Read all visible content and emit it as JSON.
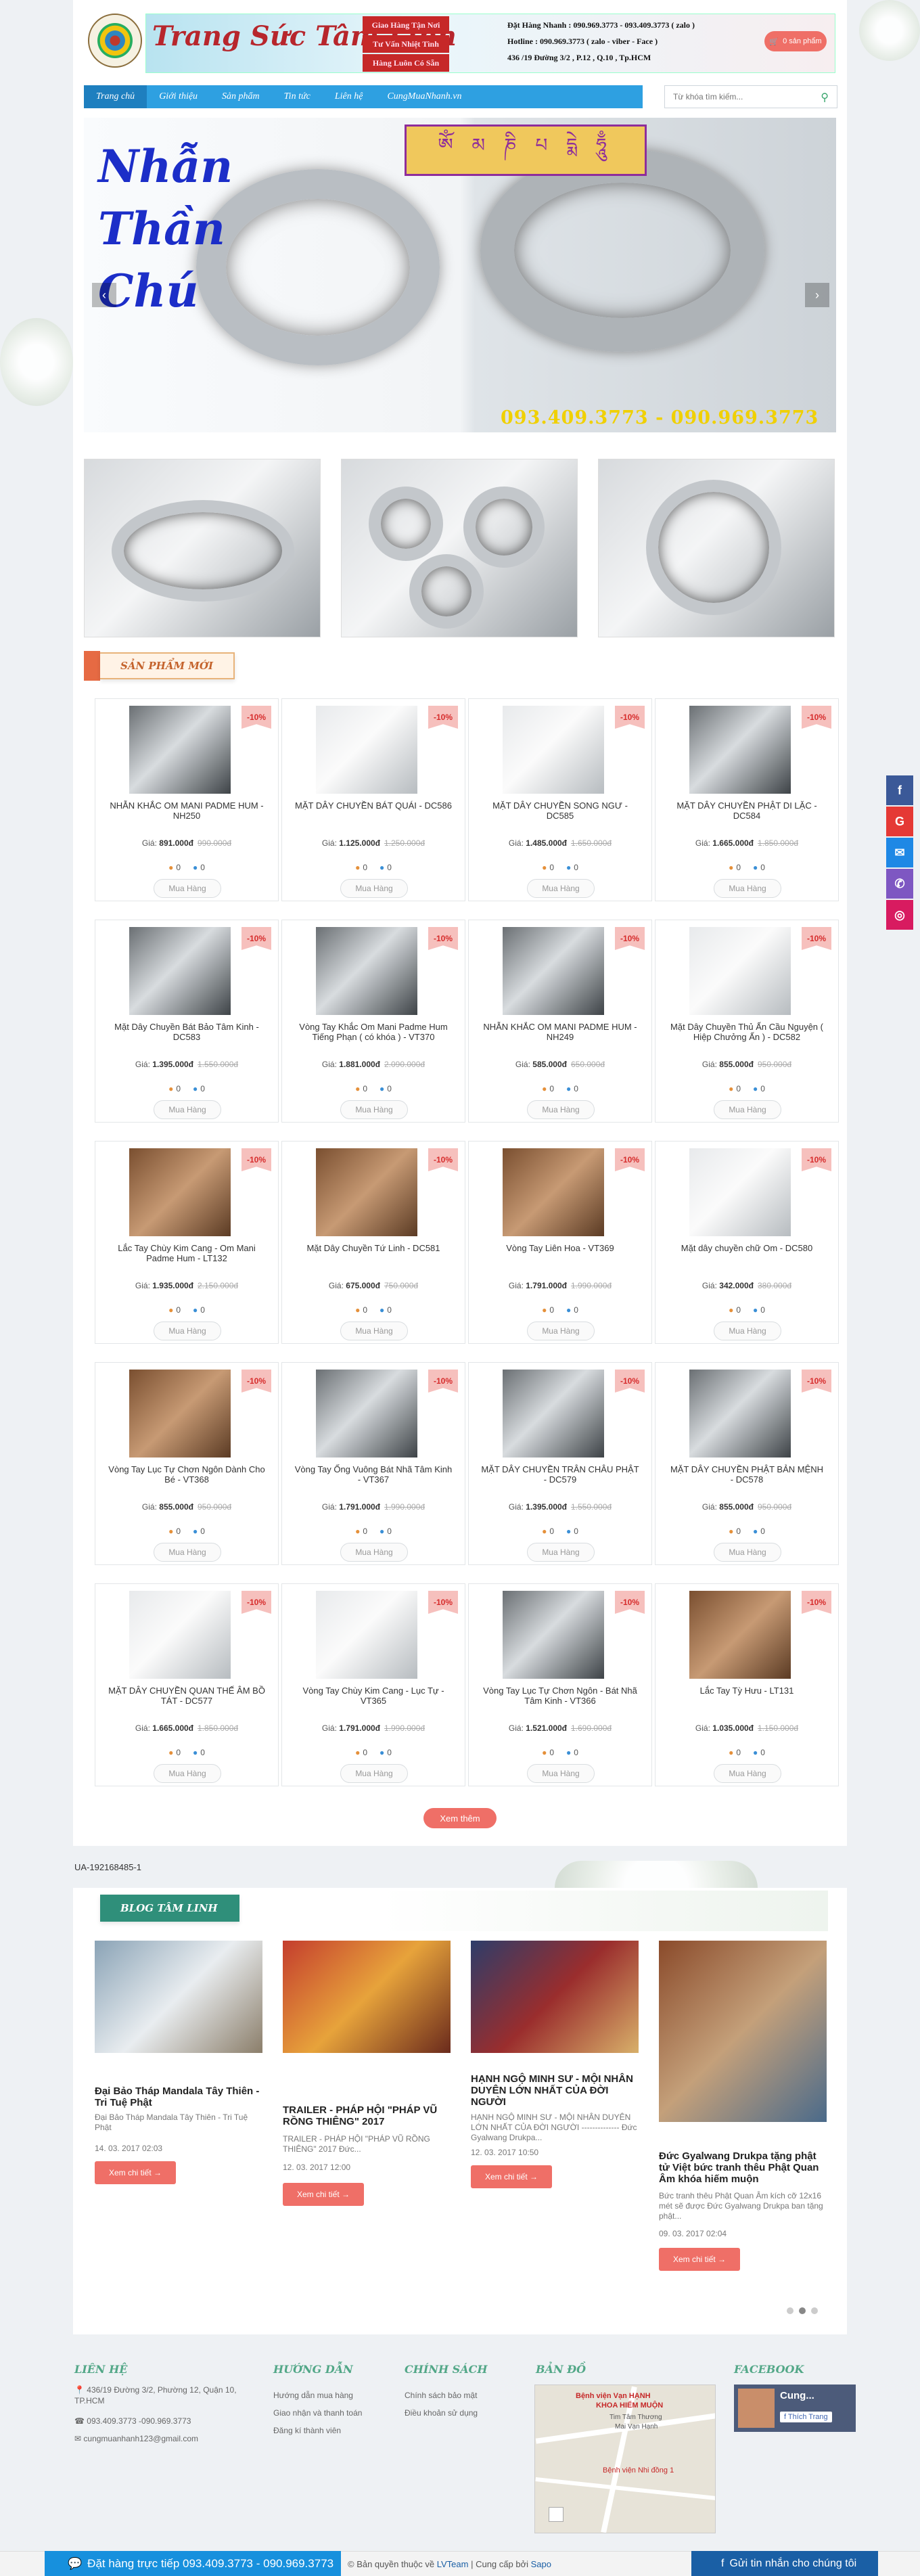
{
  "header": {
    "brand": "Trang Sức Tâm Linh",
    "tags": [
      "Giao Hàng Tận Nơi",
      "Tư Vấn Nhiệt Tình",
      "Hàng Luôn Có Sẵn"
    ],
    "info_lines": [
      "Đặt Hàng Nhanh : 090.969.3773 - 093.409.3773 ( zalo )",
      "Hotline : 090.969.3773 ( zalo - viber - Face )",
      "436 /19 Đường 3/2 , P.12 , Q.10 , Tp.HCM"
    ],
    "cart_label": "0 sản phẩm"
  },
  "nav": {
    "items": [
      "Trang chủ",
      "Giới thiệu",
      "Sản phẩm",
      "Tin tức",
      "Liên hệ",
      "CungMuaNhanh.vn"
    ],
    "search_placeholder": "Từ khóa tìm kiếm..."
  },
  "slider": {
    "title": "Nhẫn\nThần\nChú",
    "mantra": "ༀ མ ཎི པ དྨེ ཧཱུྃ",
    "phone": "093.409.3773 - 090.969.3773"
  },
  "new_products": {
    "heading": "SẢN PHẨM MỚI",
    "buy_label": "Mua Hàng",
    "price_label": "Giá:",
    "discount": "-10%",
    "items": [
      {
        "name": "NHẪN KHẮC OM MANI PADME HUM - NH250",
        "price": "891.000đ",
        "old": "990.000đ",
        "likes": "0",
        "comments": "0",
        "img": "d"
      },
      {
        "name": "MẶT DÂY CHUYỀN BÁT QUÁI - DC586",
        "price": "1.125.000đ",
        "old": "1.250.000đ",
        "likes": "0",
        "comments": "0",
        "img": "l"
      },
      {
        "name": "MẶT DÂY CHUYỀN SONG NGƯ - DC585",
        "price": "1.485.000đ",
        "old": "1.650.000đ",
        "likes": "0",
        "comments": "0",
        "img": "l"
      },
      {
        "name": "MẶT DÂY CHUYỀN PHẬT DI LẶC - DC584",
        "price": "1.665.000đ",
        "old": "1.850.000đ",
        "likes": "0",
        "comments": "0",
        "img": "d"
      },
      {
        "name": "Mặt Dây Chuyền Bát Bảo Tâm Kinh - DC583",
        "price": "1.395.000đ",
        "old": "1.550.000đ",
        "likes": "0",
        "comments": "0",
        "img": "d"
      },
      {
        "name": "Vòng Tay Khắc Om Mani Padme Hum Tiếng Phạn ( có khóa ) - VT370",
        "price": "1.881.000đ",
        "old": "2.090.000đ",
        "likes": "0",
        "comments": "0",
        "img": "d"
      },
      {
        "name": "NHẪN KHẮC OM MANI PADME HUM - NH249",
        "price": "585.000đ",
        "old": "650.000đ",
        "likes": "0",
        "comments": "0",
        "img": "d"
      },
      {
        "name": "Mặt Dây Chuyền Thủ Ấn Cầu Nguyện ( Hiệp Chưởng Ấn ) - DC582",
        "price": "855.000đ",
        "old": "950.000đ",
        "likes": "0",
        "comments": "0",
        "img": "l"
      },
      {
        "name": "Lắc Tay Chùy Kim Cang - Om Mani Padme Hum - LT132",
        "price": "1.935.000đ",
        "old": "2.150.000đ",
        "likes": "0",
        "comments": "0",
        "img": "b"
      },
      {
        "name": "Mặt Dây Chuyền Tứ Linh - DC581",
        "price": "675.000đ",
        "old": "750.000đ",
        "likes": "0",
        "comments": "0",
        "img": "b"
      },
      {
        "name": "Vòng Tay Liên Hoa - VT369",
        "price": "1.791.000đ",
        "old": "1.990.000đ",
        "likes": "0",
        "comments": "0",
        "img": "b"
      },
      {
        "name": "Mặt dây chuyền chữ Om - DC580",
        "price": "342.000đ",
        "old": "380.000đ",
        "likes": "0",
        "comments": "0",
        "img": "l"
      },
      {
        "name": "Vòng Tay Lục Tự Chơn Ngôn Dành Cho Bé - VT368",
        "price": "855.000đ",
        "old": "950.000đ",
        "likes": "0",
        "comments": "0",
        "img": "b"
      },
      {
        "name": "Vòng Tay Ống Vuông Bát Nhã Tâm Kinh - VT367",
        "price": "1.791.000đ",
        "old": "1.990.000đ",
        "likes": "0",
        "comments": "0",
        "img": "d"
      },
      {
        "name": "MẶT DÂY CHUYỀN TRÂN CHÂU PHẬT - DC579",
        "price": "1.395.000đ",
        "old": "1.550.000đ",
        "likes": "0",
        "comments": "0",
        "img": "d"
      },
      {
        "name": "MẶT DÂY CHUYỀN PHẬT BẢN MỆNH - DC578",
        "price": "855.000đ",
        "old": "950.000đ",
        "likes": "0",
        "comments": "0",
        "img": "d"
      },
      {
        "name": "MẶT DÂY CHUYỀN QUAN THẾ ÂM BỒ TÁT - DC577",
        "price": "1.665.000đ",
        "old": "1.850.000đ",
        "likes": "0",
        "comments": "0",
        "img": "l"
      },
      {
        "name": "Vòng Tay Chùy Kim Cang - Lục Tự - VT365",
        "price": "1.791.000đ",
        "old": "1.990.000đ",
        "likes": "0",
        "comments": "0",
        "img": "l"
      },
      {
        "name": "Vòng Tay Lục Tự Chơn Ngôn - Bát Nhã Tâm Kinh - VT366",
        "price": "1.521.000đ",
        "old": "1.690.000đ",
        "likes": "0",
        "comments": "0",
        "img": "d"
      },
      {
        "name": "Lắc Tay Tỳ Hưu - LT131",
        "price": "1.035.000đ",
        "old": "1.150.000đ",
        "likes": "0",
        "comments": "0",
        "img": "b"
      }
    ],
    "more_label": "Xem thêm"
  },
  "ua_code": "UA-192168485-1",
  "blog": {
    "heading": "BLOG TÂM LINH",
    "read_more": "Xem chi tiết →",
    "posts": [
      {
        "title": "Đại Bảo Tháp Mandala Tây Thiên - Tri Tuệ Phật",
        "excerpt": "Đại Bảo Tháp Mandala Tây Thiên - Tri Tuệ Phật",
        "date": "14. 03. 2017 02:03"
      },
      {
        "title": "TRAILER - PHÁP HỘI \"PHÁP VŨ RỒNG THIÊNG\" 2017",
        "excerpt": "TRAILER - PHÁP HỘI \"PHÁP VŨ RỒNG THIÊNG\" 2017 Đức...",
        "date": "12. 03. 2017 12:00"
      },
      {
        "title": "HẠNH NGỘ MINH SƯ - MỘI NHÂN DUYÊN LỚN NHẤT CỦA ĐỜI NGƯỜI",
        "excerpt": "HẠNH NGỘ MINH SƯ - MỘI NHÂN DUYÊN LỚN NHẤT CỦA ĐỜI NGƯỜI -------------- Đức Gyalwang Drukpa...",
        "date": "12. 03. 2017 10:50"
      },
      {
        "title": "Đức Gyalwang Drukpa tặng phật tử Việt bức tranh thêu Phật Quan Âm khóa hiếm muộn",
        "excerpt": "Bức tranh thêu Phật Quan Âm kích cỡ 12x16 mét sẽ được Đức Gyalwang Drukpa ban tặng phật...",
        "date": "09. 03. 2017 02:04"
      }
    ]
  },
  "footer": {
    "contact_heading": "LIÊN HỆ",
    "address": "436/19 Đường 3/2, Phường 12, Quận 10, TP.HCM",
    "phones": "093.409.3773 -090.969.3773",
    "email": "cungmuanhanh123@gmail.com",
    "guide_heading": "HƯỚNG DẪN",
    "guide_items": [
      "Hướng dẫn mua hàng",
      "Giao nhận và thanh toán",
      "Đăng kí thành viên"
    ],
    "policy_heading": "CHÍNH SÁCH",
    "policy_items": [
      "Chính sách bảo mật",
      "Điều khoản sử dụng"
    ],
    "map_heading": "BẢN ĐỒ",
    "map_labels": [
      "Bệnh viện Vạn HẠNH",
      "KHOA HIẾM MUỘN",
      "Bệnh viện Nhi đồng 1",
      "Tim Tâm Thương",
      "Mai Vạn Hạnh"
    ],
    "facebook_heading": "FACEBOOK",
    "fb_name": "Cung...",
    "fb_like": "Thích Trang"
  },
  "bottom": {
    "call": "Đặt hàng trực tiếp 093.409.3773 - 090.969.3773",
    "copyright_prefix": "© Bản quyền thuộc về",
    "team": "LVTeam",
    "provider_prefix": "| Cung cấp bởi",
    "provider": "Sapo",
    "message": "Gửi tin nhắn cho chúng tôi"
  },
  "colors": {
    "accent": "#ef6f67",
    "nav": "#2ea0e1",
    "brand_red": "#b7262c",
    "footer_green": "#52a787"
  }
}
